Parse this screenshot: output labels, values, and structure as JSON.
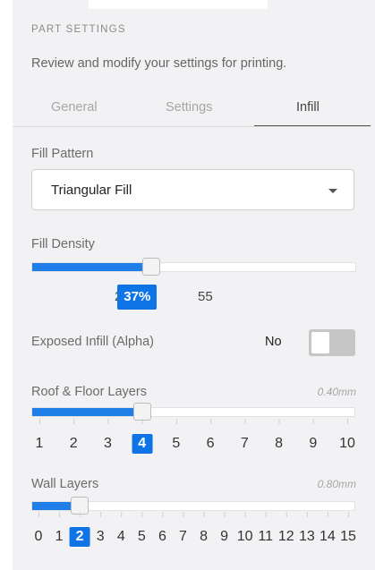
{
  "panel": {
    "section_label": "PART SETTINGS",
    "subtitle": "Review and modify your settings for printing."
  },
  "tabs": [
    {
      "label": "General",
      "active": false
    },
    {
      "label": "Settings",
      "active": false
    },
    {
      "label": "Infill",
      "active": true
    }
  ],
  "fill_pattern": {
    "label": "Fill Pattern",
    "value": "Triangular Fill",
    "icon": "caret-down-icon"
  },
  "fill_density": {
    "label": "Fill Density",
    "min_label": "28",
    "max_label": "55",
    "value_label": "37%",
    "fill_fraction": 0.37
  },
  "exposed_infill": {
    "label": "Exposed Infill (Alpha)",
    "state_label": "No",
    "on": false
  },
  "roof_floor": {
    "label": "Roof & Floor Layers",
    "measure": "0.40mm",
    "scale": [
      "1",
      "2",
      "3",
      "4",
      "5",
      "6",
      "7",
      "8",
      "9",
      "10"
    ],
    "selected": "4"
  },
  "wall_layers": {
    "label": "Wall Layers",
    "measure": "0.80mm",
    "scale": [
      "0",
      "1",
      "2",
      "3",
      "4",
      "5",
      "6",
      "7",
      "8",
      "9",
      "10",
      "11",
      "12",
      "13",
      "14",
      "15"
    ],
    "selected": "2"
  },
  "colors": {
    "accent": "#0f74e6",
    "panel_bg": "#f2f2f4",
    "toggle_off": "#c6c6c6"
  }
}
